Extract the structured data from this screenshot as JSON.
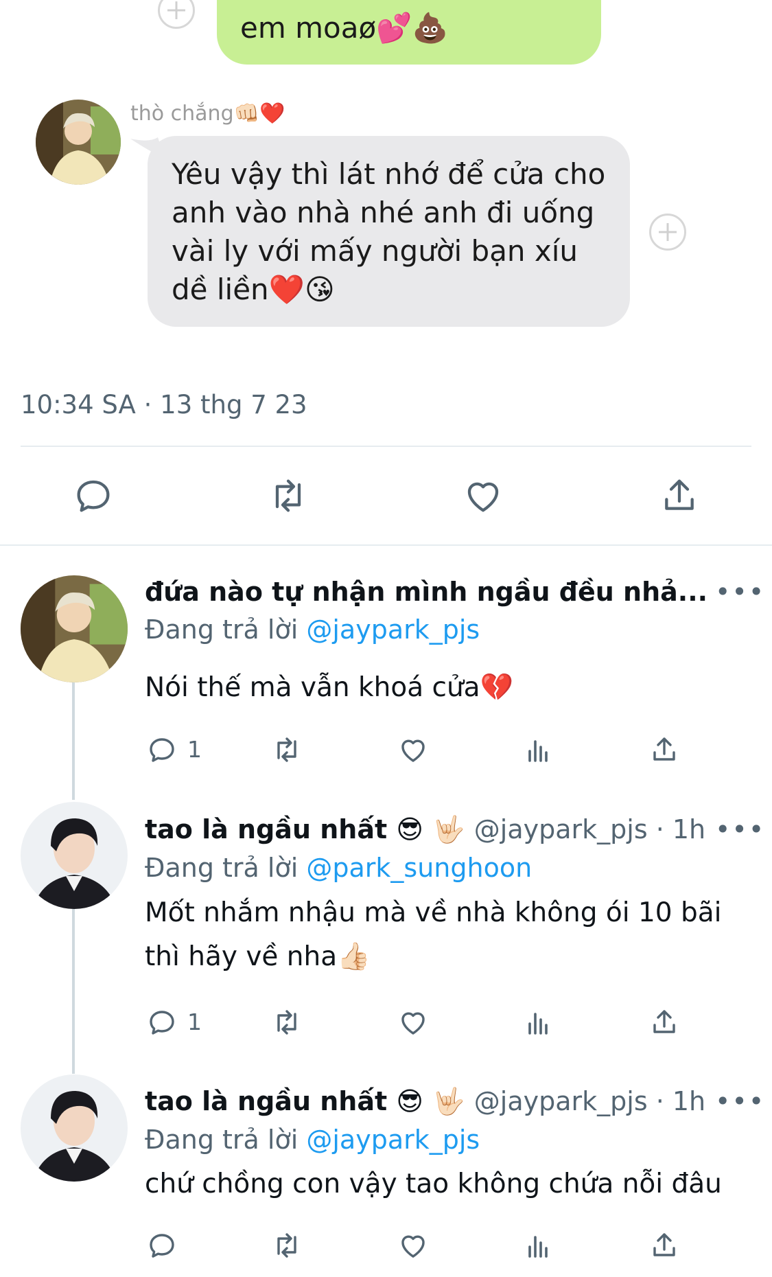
{
  "chat": {
    "top_message": "em moaø💕💩",
    "sender_name": "thò chắng👊🏻❤️",
    "message": "Yêu vậy thì lát nhớ để cửa cho anh vào nhà nhé anh đi uống vài ly với mấy người bạn xíu dề liền❤️😘"
  },
  "tweet": {
    "timestamp": "10:34 SA · 13 thg 7 23"
  },
  "replies": [
    {
      "display_name": "đứa nào tự nhận mình ngầu đều nhả...",
      "handle": "",
      "time": "",
      "replying_prefix": "Đang trả lời",
      "replying_to": "@jaypark_pjs",
      "text": "Nói thế mà vẫn khoá cửa💔",
      "reply_count": "1"
    },
    {
      "display_name": "tao là ngầu nhất 😎 🤟🏻",
      "handle": "@jaypark_pjs · 1h",
      "replying_prefix": "Đang trả lời",
      "replying_to": "@park_sunghoon",
      "text": "Mốt nhắm nhậu mà về nhà không ói 10 bãi thì hãy về nha👍🏻",
      "reply_count": "1"
    },
    {
      "display_name": "tao là ngầu nhất 😎 🤟🏻",
      "handle": "@jaypark_pjs · 1h",
      "replying_prefix": "Đang trả lời",
      "replying_to": "@jaypark_pjs",
      "text": "chứ chồng con vậy tao không chứa nỗi đâu",
      "reply_count": ""
    }
  ],
  "more_label": "•••",
  "colors": {
    "accent": "#1d9bf0",
    "secondary_text": "#536471",
    "chat_green": "#c8ef94",
    "chat_gray": "#e9e9eb"
  },
  "icons": [
    "plus-circle-icon",
    "reply-icon",
    "retweet-icon",
    "like-icon",
    "share-icon",
    "views-icon",
    "more-icon"
  ]
}
